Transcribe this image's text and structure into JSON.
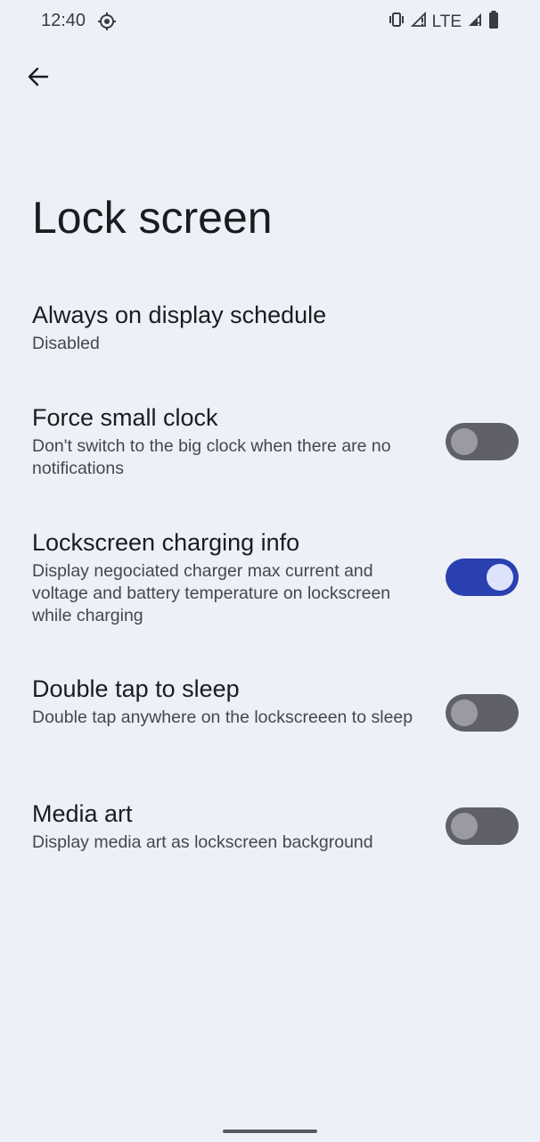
{
  "status_bar": {
    "time": "12:40",
    "network": "LTE",
    "icons": [
      "settings-icon",
      "vibrate-icon",
      "signal-icon",
      "signal-icon",
      "battery-icon"
    ]
  },
  "header": {
    "back_icon": "arrow-back-icon",
    "title": "Lock screen"
  },
  "settings": [
    {
      "title": "Always on display schedule",
      "summary": "Disabled"
    },
    {
      "title": "Force small clock",
      "summary": "Don't switch to the big clock when there are no notifications",
      "toggle": false
    },
    {
      "title": "Lockscreen charging info",
      "summary": "Display negociated charger max current and voltage and battery temperature on lockscreen while charging",
      "toggle": true
    },
    {
      "title": "Double tap to sleep",
      "summary": "Double tap anywhere on the lockscreeen to sleep",
      "toggle": false
    },
    {
      "title": "Media art",
      "summary": "Display media art as lockscreen background",
      "toggle": false
    }
  ],
  "colors": {
    "background": "#eef0f8",
    "toggle_on": "#2a3fb0",
    "toggle_off": "#5f6068"
  }
}
